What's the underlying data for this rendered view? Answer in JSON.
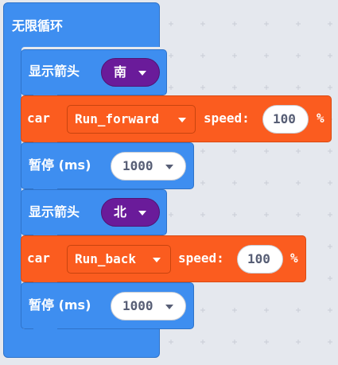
{
  "forever": {
    "label": "无限循环"
  },
  "blocks": [
    {
      "kind": "show_arrow",
      "label": "显示箭头",
      "direction": "南"
    },
    {
      "kind": "car_run",
      "car_label": "car",
      "action": "Run_forward",
      "speed_label": "speed:",
      "speed_value": "100",
      "percent": "%"
    },
    {
      "kind": "pause",
      "label": "暂停 (ms)",
      "value": "1000"
    },
    {
      "kind": "show_arrow",
      "label": "显示箭头",
      "direction": "北"
    },
    {
      "kind": "car_run",
      "car_label": "car",
      "action": "Run_back",
      "speed_label": "speed:",
      "speed_value": "100",
      "percent": "%"
    },
    {
      "kind": "pause",
      "label": "暂停 (ms)",
      "value": "1000"
    }
  ],
  "colors": {
    "workspace": "#e5e8ee",
    "basic_blue": "#3e8ef0",
    "car_orange": "#fb5c1f",
    "arrow_purple": "#6a1b9a",
    "value_text": "#575e75"
  },
  "icons": {
    "dropdown": "chevron-down-icon"
  }
}
